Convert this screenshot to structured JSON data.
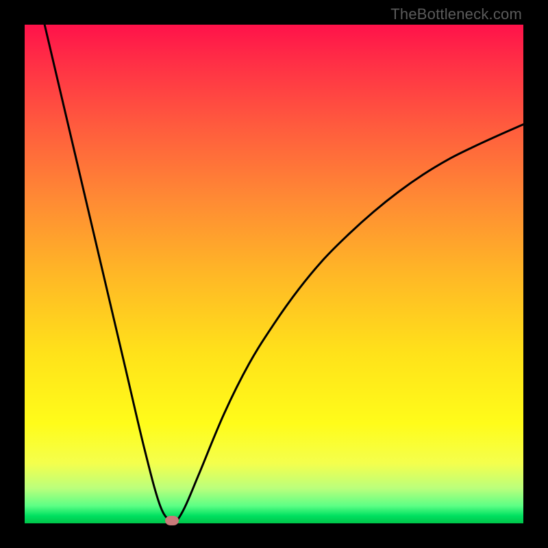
{
  "watermark": "TheBottleneck.com",
  "colors": {
    "frame": "#000000",
    "curve": "#000000",
    "marker": "#c97a7a",
    "gradient_top": "#ff124a",
    "gradient_bottom": "#00c44a"
  },
  "chart_data": {
    "type": "line",
    "title": "",
    "xlabel": "",
    "ylabel": "",
    "xlim": [
      0,
      100
    ],
    "ylim": [
      0,
      100
    ],
    "grid": false,
    "legend": false,
    "annotations": [],
    "series": [
      {
        "name": "left-branch",
        "x": [
          4,
          8,
          12,
          16,
          20,
          24,
          27,
          29,
          30
        ],
        "values": [
          100,
          83,
          66,
          49,
          32,
          15,
          4,
          0.5,
          0
        ]
      },
      {
        "name": "right-branch",
        "x": [
          30,
          32,
          35,
          40,
          45,
          50,
          55,
          60,
          65,
          70,
          75,
          80,
          85,
          90,
          95,
          100
        ],
        "values": [
          0,
          3,
          10,
          22,
          32,
          40,
          47,
          53,
          58,
          62.5,
          66.5,
          70,
          73,
          75.5,
          77.8,
          80
        ]
      }
    ],
    "marker": {
      "x": 29.6,
      "y": 0.5
    }
  }
}
